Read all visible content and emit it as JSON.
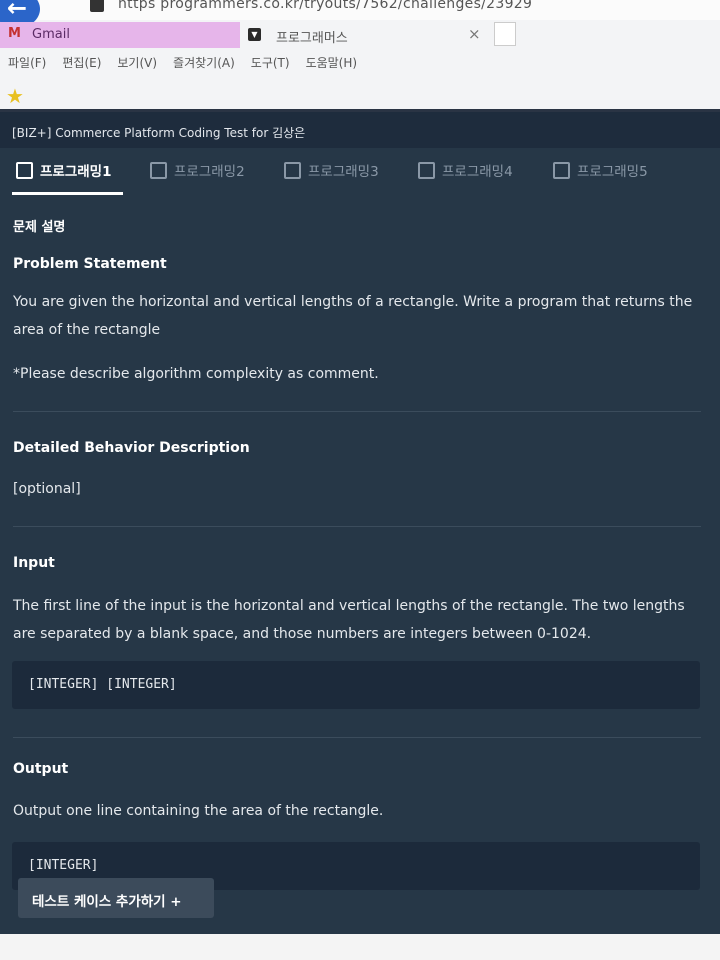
{
  "browser": {
    "url": "https   programmers.co.kr/tryouts/7562/challenges/23929",
    "tabs": [
      {
        "label": "Gmail",
        "icon": "gmail-icon"
      },
      {
        "label": "프로그래머스",
        "icon": "programmers-favicon"
      }
    ],
    "menu": [
      "파일(F)",
      "편집(E)",
      "보기(V)",
      "즐겨찾기(A)",
      "도구(T)",
      "도움말(H)"
    ]
  },
  "app": {
    "title": "[BIZ+] Commerce Platform Coding Test for 김상은",
    "problem_tabs": [
      "프로그래밍1",
      "프로그래밍2",
      "프로그래밍3",
      "프로그래밍4",
      "프로그래밍5"
    ],
    "active_tab": 0,
    "section_title": "문제 설명",
    "problem_statement": {
      "heading": "Problem Statement",
      "text": "You are given the horizontal and vertical lengths of a rectangle. Write a program that returns the area of the rectangle",
      "note": "*Please describe algorithm complexity as comment."
    },
    "behavior": {
      "heading": "Detailed Behavior Description",
      "text": "[optional]"
    },
    "input": {
      "heading": "Input",
      "text": "The first line of the input is the horizontal and vertical lengths of the rectangle. The two lengths are separated by a blank space, and those numbers are integers between 0-1024.",
      "code": "[INTEGER] [INTEGER]"
    },
    "output": {
      "heading": "Output",
      "text": "Output one line containing the area of the rectangle.",
      "code": "[INTEGER]"
    },
    "add_test_button": "테스트 케이스 추가하기 +"
  }
}
